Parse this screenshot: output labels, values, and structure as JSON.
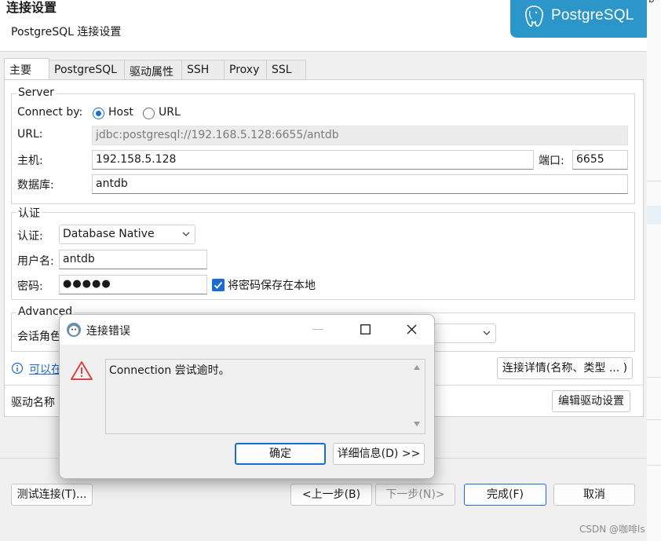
{
  "window": {
    "title": "连接设置",
    "subtitle": "PostgreSQL 连接设置",
    "logo_text": "PostgreSQL",
    "edge_text": "b"
  },
  "tabs": [
    {
      "label": "主要",
      "active": true
    },
    {
      "label": "PostgreSQL",
      "active": false
    },
    {
      "label": "驱动属性",
      "active": false
    },
    {
      "label": "SSH",
      "active": false
    },
    {
      "label": "Proxy",
      "active": false
    },
    {
      "label": "SSL",
      "active": false
    }
  ],
  "server": {
    "group_title": "Server",
    "connect_by_label": "Connect by:",
    "option_host": "Host",
    "option_url": "URL",
    "selected": "Host",
    "url_label": "URL:",
    "url_value": "jdbc:postgresql://192.168.5.128:6655/antdb",
    "host_label": "主机:",
    "host_value": "192.158.5.128",
    "port_label": "端口:",
    "port_value": "6655",
    "db_label": "数据库:",
    "db_value": "antdb"
  },
  "auth": {
    "group_title": "认证",
    "auth_label": "认证:",
    "auth_value": "Database Native",
    "user_label": "用户名:",
    "user_value": "antdb",
    "password_label": "密码:",
    "password_value": "●●●●●",
    "save_password_label": "将密码保存在本地",
    "save_password_checked": true
  },
  "advanced": {
    "group_title": "Advanced",
    "session_role_label": "会话角色"
  },
  "info": {
    "link_text": "可以在",
    "details_button": "连接详情(名称、类型 ... )"
  },
  "driver": {
    "label": "驱动名称",
    "edit_button": "编辑驱动设置"
  },
  "footer": {
    "test_button": "测试连接(T)...",
    "back_button": "<上一步(B)",
    "next_button": "下一步(N)>",
    "finish_button": "完成(F)",
    "cancel_button": "取消"
  },
  "dialog": {
    "title": "连接错误",
    "message": "Connection 尝试逾时。",
    "ok_button": "确定",
    "details_button": "详细信息(D) >>"
  },
  "watermark": "CSDN @咖啡ls",
  "colors": {
    "accent": "#1a6bd2",
    "logo_bg": "#2c96c8",
    "error_red": "#d9434b"
  }
}
